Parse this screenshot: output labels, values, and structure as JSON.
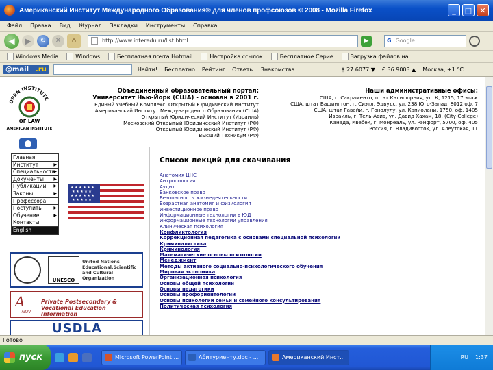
{
  "window": {
    "title": "Американский Институт Международного Образования® для членов профсоюзов © 2008 - Mozilla Firefox",
    "controls": [
      "_",
      "□",
      "✕"
    ]
  },
  "menubar": [
    "Файл",
    "Правка",
    "Вид",
    "Журнал",
    "Закладки",
    "Инструменты",
    "Справка"
  ],
  "navbar": {
    "url": "http://www.interedu.ru/list.html",
    "search_placeholder": "Google",
    "search_engine": "G"
  },
  "bookmarks": [
    "Windows Media",
    "Windows",
    "Бесплатная почта Hotmail",
    "Настройка ссылок",
    "Бесплатное Cерие",
    "Загрузка файлов на..."
  ],
  "mailbar": {
    "logo_a": "@mail",
    "logo_b": ".ru",
    "find": "Найти!",
    "items": [
      "Бесплатно",
      "Рейтинг",
      "Ответы",
      "Знакомства"
    ],
    "usd": "$ 27.6077 ▼",
    "eur": "€ 36.9003 ▲",
    "weather": "Москва, +1 °C"
  },
  "header": {
    "left_title": "Объединенный образовательный портал:",
    "left_subtitle": "Университет Нью-Йорк (США) - основан в 2001 г.",
    "left_lines": [
      "Единый Учебный Комплекс: Открытый Юридический Институт",
      "Американский Институт Международного Образования (США)",
      "Открытый Юридический Институт (Израиль)",
      "Московский Открытый Юридический Институт (РФ)",
      "Открытый Юридический Институт (РФ)",
      "Высший Техникум (РФ)"
    ],
    "right_title": "Наши административные офисы:",
    "right_lines": [
      "США, г. Сакраменто, штат Калифорния, ул. К, 1215, 17 этаж",
      "США, штат Вашингтон, г. Сиэтл, Эдвудс, ул. 238 Юго-Запад, 8012 оф. 7",
      "США, штат Гавайи, г. Гонолулу, ул. Капиолани, 1750, оф. 1405",
      "Израиль, г. Тель-Авив, ул. Давид Хахам, 18, (City-College)",
      "Канада, Квебек, г. Монреаль, ул. Рэнфорт, 5700, оф. 405",
      "Россия, г. Владивосток, ул. Алеутская, 11"
    ],
    "logo_top": "OPEN INSTITUTE",
    "logo_bottom": "OF LAW",
    "logo_sub": "AMERICAN INSTITUTE"
  },
  "left_menu": [
    {
      "label": "Главная",
      "arrow": false,
      "dark": false
    },
    {
      "label": "Институт",
      "arrow": true,
      "dark": false
    },
    {
      "label": "Специальности",
      "arrow": true,
      "dark": false
    },
    {
      "label": "Документы",
      "arrow": true,
      "dark": false
    },
    {
      "label": "Публикации",
      "arrow": true,
      "dark": false
    },
    {
      "label": "Законы",
      "arrow": true,
      "dark": false
    },
    {
      "label": "Профессора",
      "arrow": false,
      "dark": false
    },
    {
      "label": "Поступить",
      "arrow": true,
      "dark": false
    },
    {
      "label": "Обучение",
      "arrow": true,
      "dark": false
    },
    {
      "label": "Контакты",
      "arrow": false,
      "dark": false
    },
    {
      "label": "English",
      "arrow": false,
      "dark": true
    }
  ],
  "partners": {
    "un_text": "United Nations Educational,Scientific and Cultural Organization",
    "unesco": "UNESCO",
    "agov_a": "A",
    "agov_gov": ".GOV",
    "agov_text": "Private Postsecondary & Vocational Education Information",
    "usdla": "USDLA"
  },
  "lectures": {
    "heading": "Список лекций для скачивания",
    "items": [
      {
        "label": "Анатомия ЦНС",
        "u": false
      },
      {
        "label": "Антропология",
        "u": false
      },
      {
        "label": "Аудит",
        "u": false
      },
      {
        "label": "Банковское право",
        "u": false
      },
      {
        "label": "Безопасность жизнедеятельности",
        "u": false
      },
      {
        "label": "Возрастная анатомия и физиология",
        "u": false
      },
      {
        "label": "Инвестиционное право",
        "u": false
      },
      {
        "label": "Информационные технологии в ЮД",
        "u": false
      },
      {
        "label": "Информационные технологии управления",
        "u": false
      },
      {
        "label": "Клиническая психология",
        "u": false
      },
      {
        "label": "Конфликтология",
        "u": true
      },
      {
        "label": "Коррекционная педагогика с основами специальной психологии",
        "u": true
      },
      {
        "label": "Криминалистика",
        "u": true
      },
      {
        "label": "Криминология",
        "u": true
      },
      {
        "label": "Математические основы психологии",
        "u": true
      },
      {
        "label": "Менеджмент",
        "u": true
      },
      {
        "label": "Методы активного социально-психологического обучения",
        "u": true
      },
      {
        "label": "Мировая экономика",
        "u": true
      },
      {
        "label": "Организационная психология",
        "u": true
      },
      {
        "label": "Основы общей психологии",
        "u": true
      },
      {
        "label": "Основы педагогики",
        "u": true
      },
      {
        "label": "Основы профориентологии",
        "u": true
      },
      {
        "label": "Основы психологии семьи и семейного консультирования",
        "u": true
      },
      {
        "label": "Политическая психология",
        "u": true
      }
    ]
  },
  "status": "Готово",
  "taskbar": {
    "start": "пуск",
    "tasks": [
      "Microsoft PowerPoint ...",
      "Абитуриенту.doc - ...",
      "Американский Инст..."
    ],
    "tray_lang": "RU",
    "time": "1:37"
  }
}
